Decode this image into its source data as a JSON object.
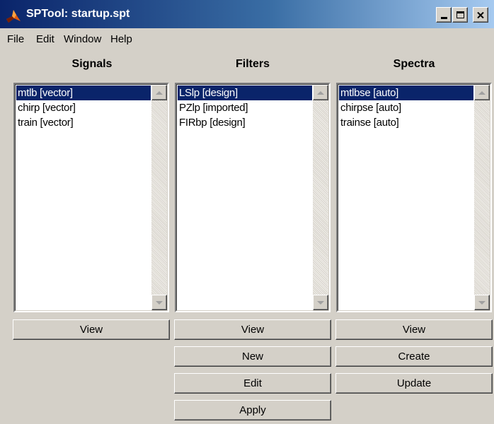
{
  "window": {
    "title": "SPTool: startup.spt",
    "icon": "matlab-membrane-icon"
  },
  "menu": [
    "File",
    "Edit",
    "Window",
    "Help"
  ],
  "columns": {
    "signals": {
      "title": "Signals",
      "items": [
        "mtlb [vector]",
        "chirp [vector]",
        "train [vector]"
      ],
      "selected": "mtlb [vector]",
      "buttons": [
        "View"
      ]
    },
    "filters": {
      "title": "Filters",
      "items": [
        "LSlp [design]",
        "PZlp [imported]",
        "FIRbp [design]"
      ],
      "selected": "LSlp [design]",
      "buttons": [
        "View",
        "New",
        "Edit",
        "Apply"
      ]
    },
    "spectra": {
      "title": "Spectra",
      "items": [
        "mtlbse [auto]",
        "chirpse [auto]",
        "trainse [auto]"
      ],
      "selected": "mtlbse [auto]",
      "buttons": [
        "View",
        "Create",
        "Update"
      ]
    }
  },
  "colors": {
    "selection": "#0a246a",
    "face": "#d4d0c8",
    "title_gradient_start": "#0a246a",
    "title_gradient_end": "#a6caf0"
  }
}
